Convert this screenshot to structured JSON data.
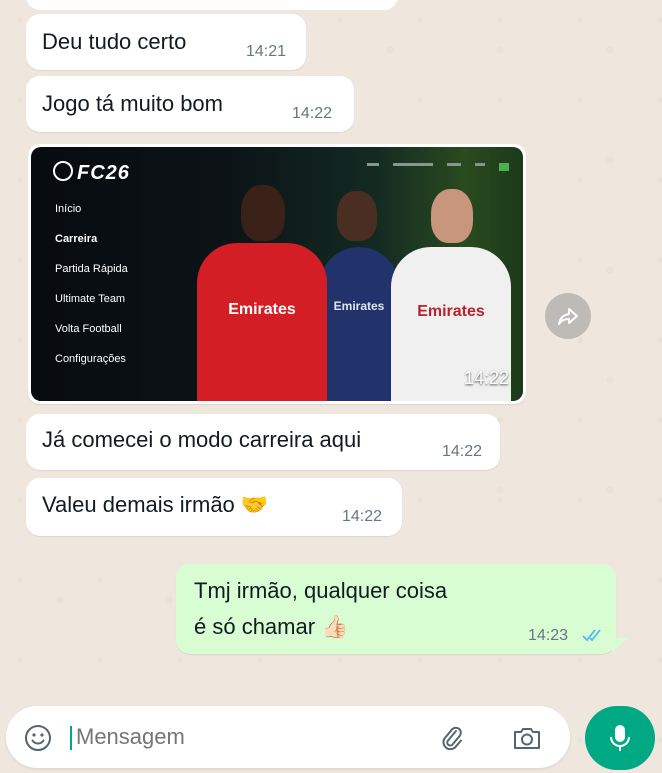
{
  "messages": [
    {
      "text": "Deu tudo certo",
      "time": "14:21"
    },
    {
      "text": "Jogo tá muito bom",
      "time": "14:22"
    },
    {
      "text": "Já comecei o modo carreira aqui",
      "time": "14:22"
    },
    {
      "text": "Valeu demais irmão 🤝",
      "time": "14:22"
    }
  ],
  "image_message": {
    "time": "14:22",
    "game": {
      "logo": "FC26",
      "menu": [
        "Início",
        "Carreira",
        "Partida Rápida",
        "Ultimate Team",
        "Volta Football",
        "Configurações"
      ],
      "sponsor_1": "Emirates",
      "sponsor_2": "Emirates"
    }
  },
  "outgoing": {
    "line1": "Tmj irmão, qualquer coisa",
    "line2": "é só chamar 👍🏻",
    "time": "14:23",
    "status_icon": "double-check-read-icon"
  },
  "input": {
    "placeholder": "Mensagem",
    "icons": [
      "emoji-icon",
      "attach-icon",
      "camera-icon",
      "mic-icon"
    ]
  },
  "colors": {
    "accent": "#00a884",
    "outgoing_bubble": "#d9fdd3",
    "read_tick": "#53bdeb"
  }
}
